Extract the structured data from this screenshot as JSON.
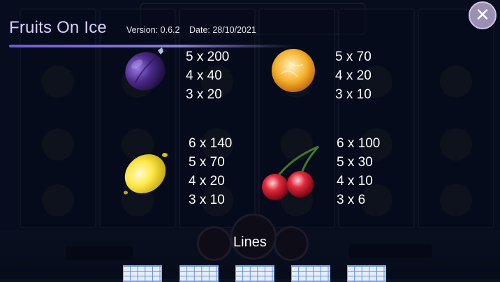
{
  "header": {
    "title": "Fruits On Ice",
    "version": "Version: 0.6.2",
    "date": "Date: 28/10/2021"
  },
  "close_icon": "close-x-icon",
  "paytable": [
    {
      "symbol": "plum",
      "icon": "plum-icon",
      "pays": [
        "5 x 200",
        "4 x 40",
        "3 x 20"
      ]
    },
    {
      "symbol": "orange",
      "icon": "orange-icon",
      "pays": [
        "5 x 70",
        "4 x 20",
        "3 x 10"
      ]
    },
    {
      "symbol": "lemon",
      "icon": "lemon-icon",
      "pays": [
        "6 x 140",
        "5 x 70",
        "4 x 20",
        "3 x 10"
      ]
    },
    {
      "symbol": "cherry",
      "icon": "cherry-icon",
      "pays": [
        "6 x 100",
        "5 x 30",
        "4 x 10",
        "3 x 6"
      ]
    }
  ],
  "lines_section": {
    "label": "Lines",
    "line_count_visible": 5
  },
  "colors": {
    "title": "#d8d0ff",
    "accent": "#6b5bd8",
    "background": "#0b1224"
  }
}
